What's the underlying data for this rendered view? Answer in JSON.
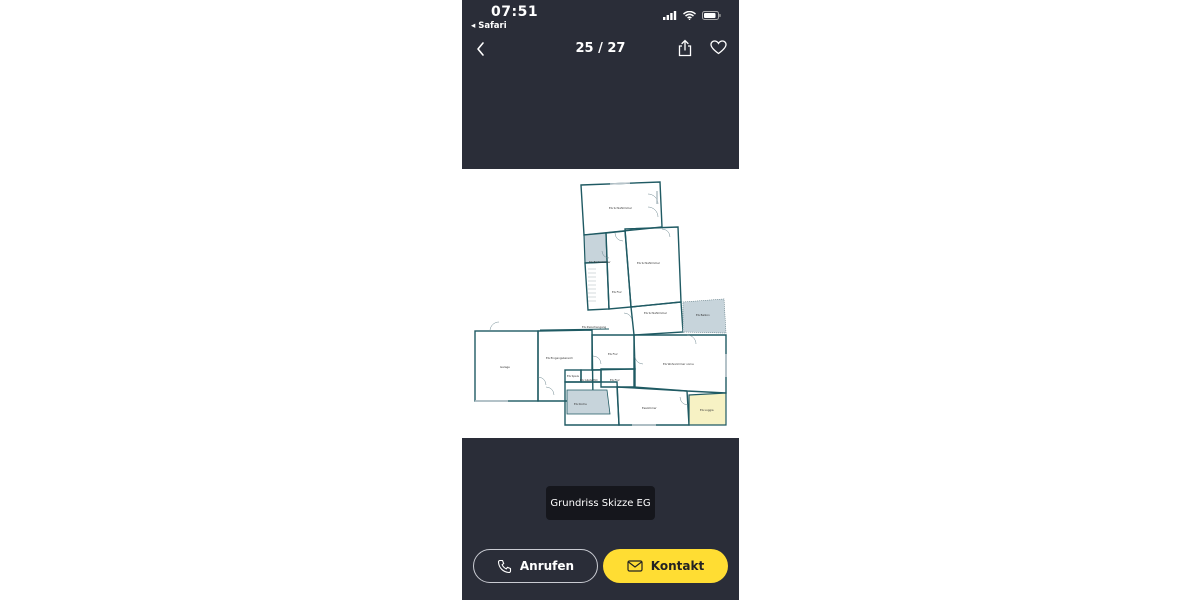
{
  "status_bar": {
    "time": "07:51",
    "back_app": "◂ Safari"
  },
  "nav": {
    "counter": "25 / 27"
  },
  "floorplan": {
    "rooms": [
      {
        "id": "schlaf1",
        "label": "EG Schlafzimmer"
      },
      {
        "id": "bad",
        "label": "EG Badezimmer"
      },
      {
        "id": "schlaf2",
        "label": "EG Schlafzimmer"
      },
      {
        "id": "flur1",
        "label": "EG Flur"
      },
      {
        "id": "schlaf3",
        "label": "EG Schlafzimmer"
      },
      {
        "id": "balkon",
        "label": "EG Balkon"
      },
      {
        "id": "zwischen",
        "label": "EG Zwischengang"
      },
      {
        "id": "garage",
        "label": "Garage"
      },
      {
        "id": "eingang",
        "label": "EG Eingangsbereich"
      },
      {
        "id": "flur2",
        "label": "EG Flur"
      },
      {
        "id": "wohn",
        "label": "EG Wohnzimmer vorne"
      },
      {
        "id": "speis",
        "label": "EG Speis"
      },
      {
        "id": "gaeste",
        "label": "EG Gäste-WC"
      },
      {
        "id": "flur3",
        "label": "EG Flur"
      },
      {
        "id": "kueche",
        "label": "EG Küche"
      },
      {
        "id": "ess",
        "label": "Esszimmer"
      },
      {
        "id": "loggia",
        "label": "EG Loggia"
      }
    ],
    "colors": {
      "wall": "#1f5a63",
      "tile": "#c7d4db",
      "loggia": "#f7f2c4",
      "balkon": "#c7d4db"
    }
  },
  "caption": "Grundriss Skizze EG",
  "actions": {
    "call_label": "Anrufen",
    "contact_label": "Kontakt"
  },
  "colors": {
    "background": "#2a2d38",
    "accent": "#ffdd33",
    "caption_bg": "#15161c"
  }
}
